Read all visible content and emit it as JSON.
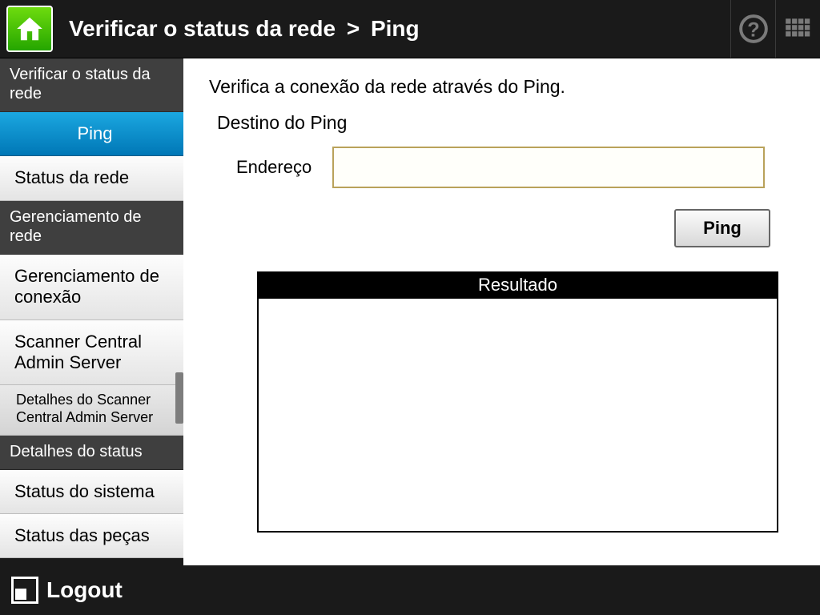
{
  "header": {
    "breadcrumb_parent": "Verificar o status da rede",
    "breadcrumb_sep": ">",
    "breadcrumb_current": "Ping"
  },
  "sidebar": {
    "group1_header": "Verificar o status da rede",
    "item_ping": "Ping",
    "item_netstatus": "Status da rede",
    "group2_header": "Gerenciamento de rede",
    "item_conn": "Gerenciamento de conexão",
    "item_scas": "Scanner Central Admin Server",
    "sub_scas_details": "Detalhes do Scanner Central Admin Server",
    "group3_header": "Detalhes do status",
    "item_sys": "Status do sistema",
    "item_parts": "Status das peças"
  },
  "main": {
    "description": "Verifica a conexão da rede através do Ping.",
    "section_title": "Destino do Ping",
    "address_label": "Endereço",
    "address_value": "",
    "ping_button": "Ping",
    "result_header": "Resultado",
    "result_body": ""
  },
  "footer": {
    "logout_label": "Logout"
  }
}
